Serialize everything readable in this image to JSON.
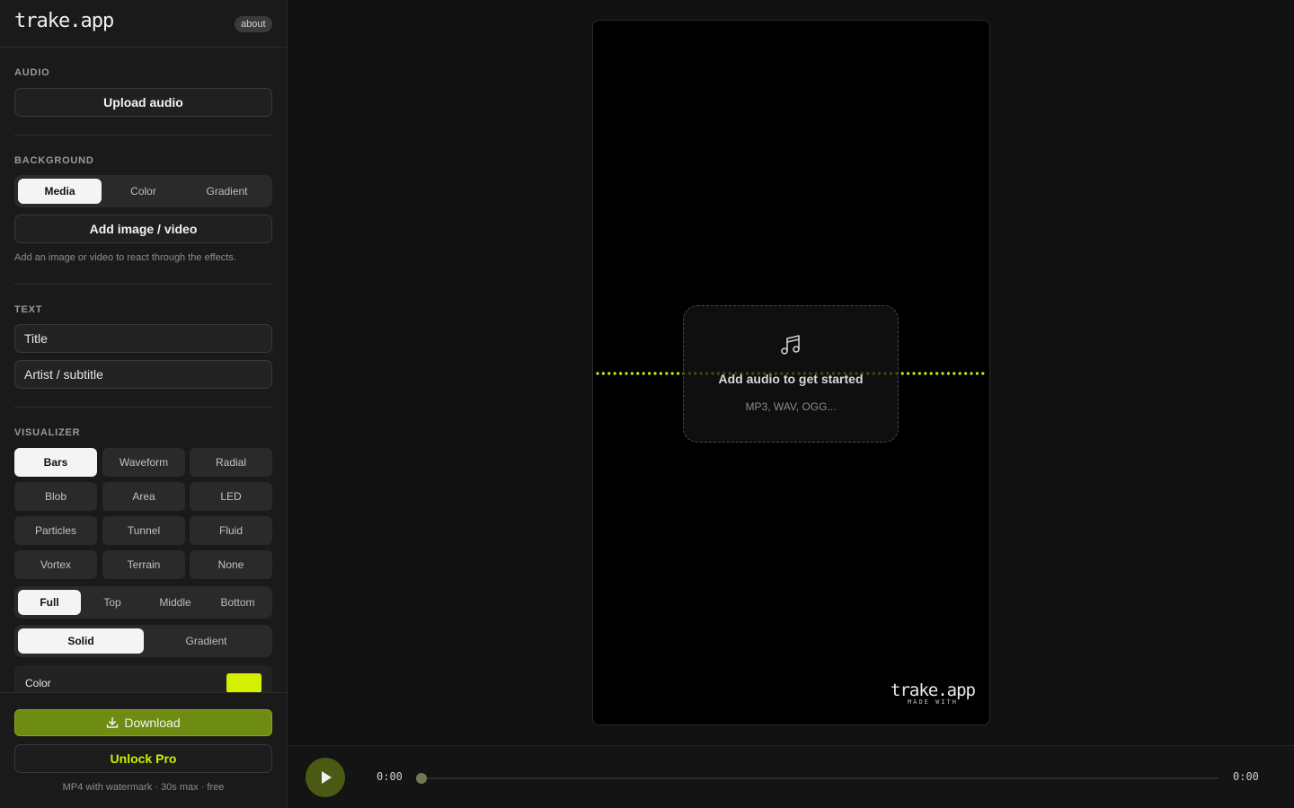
{
  "app": {
    "logo": "trake.app",
    "about_label": "about"
  },
  "audio": {
    "section_label": "AUDIO",
    "upload_label": "Upload audio"
  },
  "background": {
    "section_label": "BACKGROUND",
    "tabs": [
      "Media",
      "Color",
      "Gradient"
    ],
    "active_tab": "Media",
    "add_media_label": "Add image / video",
    "hint": "Add an image or video to react through the effects."
  },
  "text": {
    "section_label": "TEXT",
    "title_placeholder": "Title",
    "subtitle_placeholder": "Artist / subtitle"
  },
  "visualizer": {
    "section_label": "VISUALIZER",
    "styles": [
      "Bars",
      "Waveform",
      "Radial",
      "Blob",
      "Area",
      "LED",
      "Particles",
      "Tunnel",
      "Fluid",
      "Vortex",
      "Terrain",
      "None"
    ],
    "active_style": "Bars",
    "positions": [
      "Full",
      "Top",
      "Middle",
      "Bottom"
    ],
    "active_position": "Full",
    "fill_modes": [
      "Solid",
      "Gradient"
    ],
    "active_fill": "Solid",
    "color_label": "Color",
    "color_value": "#d4f000"
  },
  "footer": {
    "download_label": "Download",
    "unlock_label": "Unlock Pro",
    "note": "MP4 with watermark · 30s max · free"
  },
  "preview": {
    "drop_title": "Add audio to get started",
    "drop_formats": "MP3, WAV, OGG...",
    "watermark_logo": "trake.app",
    "watermark_sub": "MADE WITH",
    "accent_color": "#d4f000"
  },
  "player": {
    "current_time": "0:00",
    "total_time": "0:00",
    "progress": 0
  }
}
